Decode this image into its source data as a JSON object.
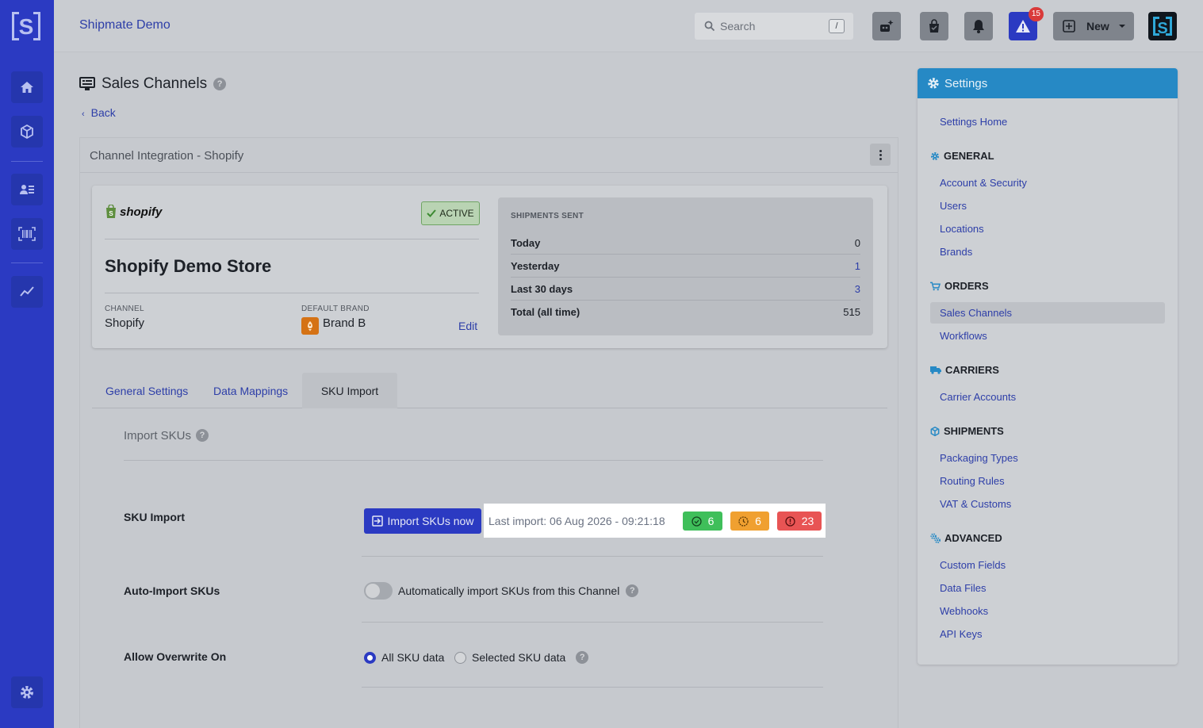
{
  "app": {
    "title": "Shipmate Demo"
  },
  "search": {
    "placeholder": "Search",
    "shortcut": "/"
  },
  "topbar": {
    "alert_count": "15",
    "new_label": "New"
  },
  "page": {
    "title": "Sales Channels",
    "back_label": "Back"
  },
  "card": {
    "title": "Channel Integration - Shopify"
  },
  "store": {
    "logo_text": "shopify",
    "status": "ACTIVE",
    "name": "Shopify Demo Store",
    "channel_label": "CHANNEL",
    "channel_value": "Shopify",
    "brand_label": "DEFAULT BRAND",
    "brand_value": "Brand B",
    "edit_label": "Edit"
  },
  "shipments": {
    "heading": "SHIPMENTS SENT",
    "rows": [
      {
        "label": "Today",
        "value": "0"
      },
      {
        "label": "Yesterday",
        "value": "1"
      },
      {
        "label": "Last 30 days",
        "value": "3"
      },
      {
        "label": "Total (all time)",
        "value": "515"
      }
    ]
  },
  "tabs": [
    "General Settings",
    "Data Mappings",
    "SKU Import"
  ],
  "sku": {
    "section_title": "Import SKUs",
    "import_label": "SKU Import",
    "import_button": "Import SKUs now",
    "last_import": "Last import: 06 Aug 2026 - 09:21:18",
    "success_count": "6",
    "pending_count": "6",
    "error_count": "23",
    "auto_label": "Auto-Import SKUs",
    "auto_text": "Automatically import SKUs from this Channel",
    "overwrite_label": "Allow Overwrite On",
    "opt_all": "All SKU data",
    "opt_selected": "Selected SKU data"
  },
  "settings": {
    "title": "Settings",
    "home": "Settings Home",
    "groups": [
      {
        "heading": "GENERAL",
        "items": [
          "Account & Security",
          "Users",
          "Locations",
          "Brands"
        ]
      },
      {
        "heading": "ORDERS",
        "items": [
          "Sales Channels",
          "Workflows"
        ]
      },
      {
        "heading": "CARRIERS",
        "items": [
          "Carrier Accounts"
        ]
      },
      {
        "heading": "SHIPMENTS",
        "items": [
          "Packaging Types",
          "Routing Rules",
          "VAT & Customs"
        ]
      },
      {
        "heading": "ADVANCED",
        "items": [
          "Custom Fields",
          "Data Files",
          "Webhooks",
          "API Keys"
        ]
      }
    ]
  },
  "colors": {
    "primary": "#2b3ac2",
    "link": "#2d3ea8",
    "settings_header": "#2689c5",
    "success": "#3fbf5a",
    "warning": "#f0a030",
    "danger": "#e85454"
  }
}
